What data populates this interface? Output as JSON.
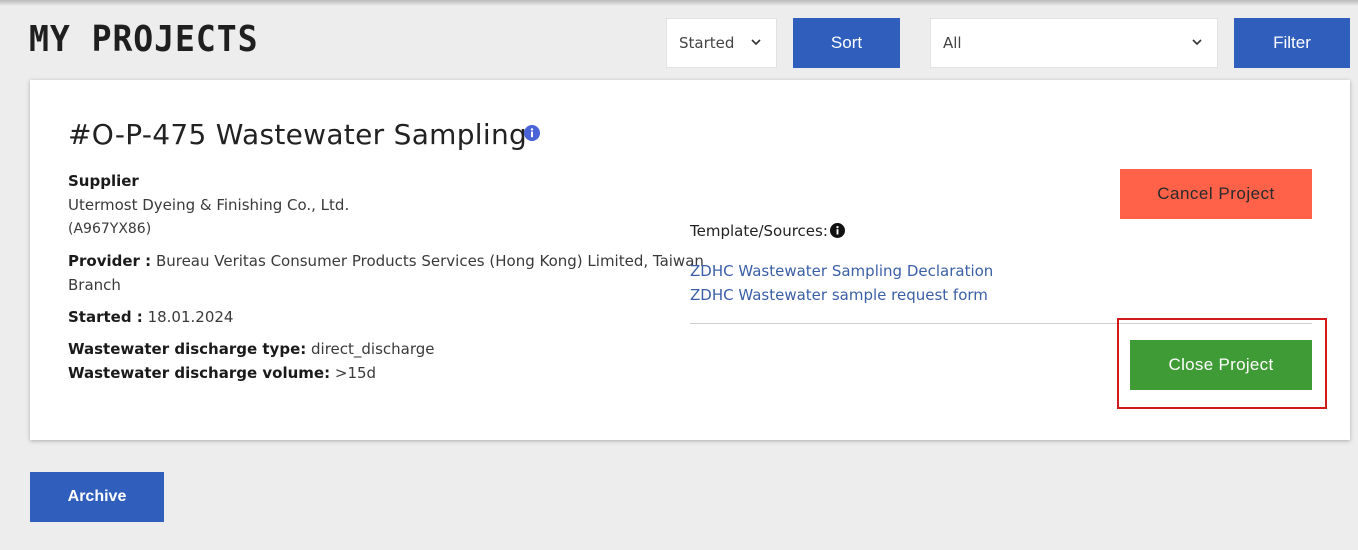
{
  "header": {
    "title": "MY PROJECTS",
    "status_select": "Started",
    "sort_label": "Sort",
    "type_select": "All",
    "filter_label": "Filter"
  },
  "project": {
    "title": "#O-P-475 Wastewater Sampling",
    "supplier_label": "Supplier",
    "supplier_name": "Utermost Dyeing & Finishing Co., Ltd.",
    "supplier_id": "(A967YX86)",
    "provider_label": "Provider :",
    "provider_value_line1": "Bureau Veritas Consumer Products Services (Hong Kong) Limited, Taiwan",
    "provider_value_line2": "Branch",
    "started_label": "Started :",
    "started_value": "18.01.2024",
    "discharge_type_label": "Wastewater discharge type:",
    "discharge_type_value": "direct_discharge",
    "discharge_volume_label": "Wastewater discharge volume:",
    "discharge_volume_value": ">15d",
    "template_label": "Template/Sources:",
    "links": [
      "ZDHC Wastewater Sampling Declaration",
      "ZDHC Wastewater sample request form"
    ],
    "cancel_label": "Cancel Project",
    "close_label": "Close Project"
  },
  "footer": {
    "archive_label": "Archive"
  },
  "colors": {
    "primary_blue": "#2f5ebd",
    "cancel_red": "#ff6249",
    "close_green": "#3f9b35",
    "highlight_red": "#d11a1a",
    "link_blue": "#3b5fa6"
  },
  "icons": [
    "chevron-down-icon",
    "info-icon"
  ]
}
